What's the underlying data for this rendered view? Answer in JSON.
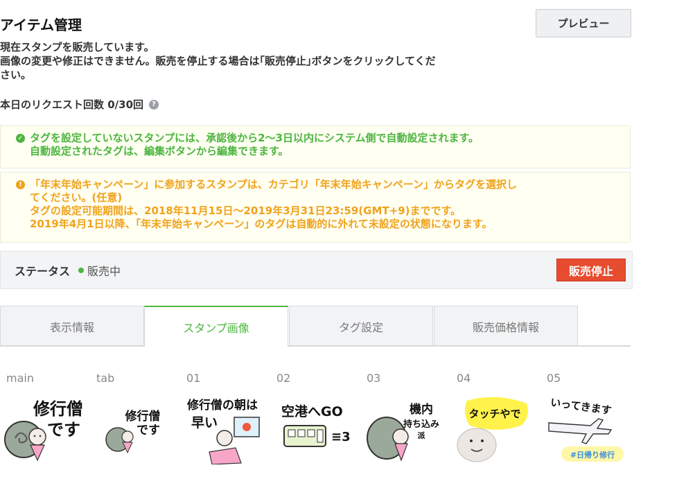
{
  "page": {
    "title": "アイテム管理",
    "preview_label": "プレビュー"
  },
  "description": {
    "line1": "現在スタンプを販売しています。",
    "line2": "画像の変更や修正はできません。販売を停止する場合は｢販売停止｣ボタンをクリックしてくだ",
    "line3": "さい。"
  },
  "request": {
    "label": "本日のリクエスト回数 0/30回",
    "help_icon": "question-circle-icon"
  },
  "notices": {
    "green": {
      "icon": "check-circle-icon",
      "line1": "タグを設定していないスタンプには、承認後から2〜3日以内にシステム側で自動設定されます。",
      "line2": "自動設定されたタグは、編集ボタンから編集できます。",
      "color": "#4cb53f"
    },
    "orange": {
      "icon": "exclamation-circle-icon",
      "line1": "「年末年始キャンペーン」に参加するスタンプは、カテゴリ「年末年始キャンペーン」からタグを選択し",
      "line2": "てください。(任意)",
      "line3": "タグの設定可能期間は、2018年11月15日〜2019年3月31日23:59(GMT+9)までです。",
      "line4": "2019年4月1日以降、「年末年始キャンペーン」のタグは自動的に外れて未設定の状態になります。",
      "color": "#f0a21a"
    }
  },
  "status": {
    "label": "ステータス",
    "value": "販売中",
    "stop_label": "販売停止",
    "accent": "#e74c2e"
  },
  "tabs": [
    {
      "label": "表示情報",
      "active": false
    },
    {
      "label": "スタンプ画像",
      "active": true
    },
    {
      "label": "タグ設定",
      "active": false
    },
    {
      "label": "販売価格情報",
      "active": false
    }
  ],
  "stickers": [
    {
      "label": "main",
      "text1": "修行僧",
      "text2": "です",
      "art": "monk-snail"
    },
    {
      "label": "tab",
      "text1": "修行僧",
      "text2": "です",
      "art": "monk-snail"
    },
    {
      "label": "01",
      "text1": "修行僧の朝は",
      "text2": "早い",
      "art": "monk-sun"
    },
    {
      "label": "02",
      "text1": "空港へGO",
      "text2": "≡3",
      "art": "train"
    },
    {
      "label": "03",
      "text1": "機内",
      "text2": "持ち込み",
      "text3": "派",
      "art": "monk-snail"
    },
    {
      "label": "04",
      "text1": "タッチやで",
      "text2": "",
      "art": "blob-face"
    },
    {
      "label": "05",
      "text1": "いってきます",
      "text2": "#日帰り修行",
      "art": "airplane"
    }
  ]
}
